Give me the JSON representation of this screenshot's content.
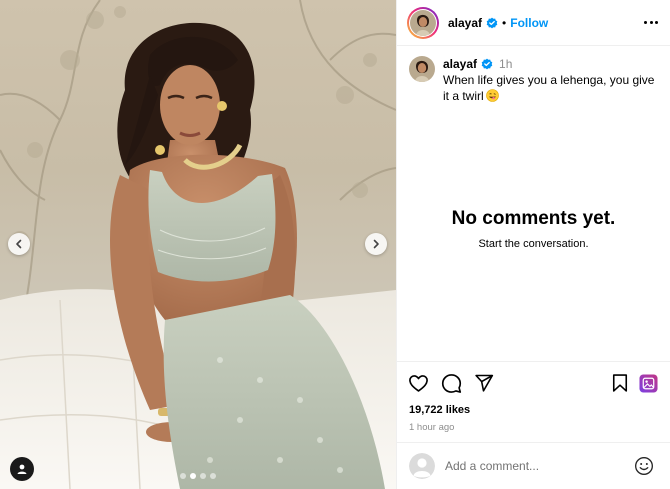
{
  "post": {
    "username": "alayaf",
    "follow_label": "Follow",
    "separator": "•",
    "caption_text": "When life gives you a lehenga, you give it a twirl",
    "caption_time": "1h",
    "caption_emoji": "grinning-tongue-emoji",
    "likes": "19,722 likes",
    "posted_ago": "1 hour ago"
  },
  "comments": {
    "empty_title": "No comments yet.",
    "empty_subtitle": "Start the conversation."
  },
  "comment_box": {
    "placeholder": "Add a comment..."
  },
  "carousel": {
    "slide_count": 4,
    "active_slide": 2
  },
  "icons": {
    "verified": "verified-badge-icon",
    "more": "more-options-icon",
    "like": "heart-icon",
    "comment": "comment-bubble-icon",
    "share": "send-icon",
    "save": "bookmark-icon",
    "media": "gallery-icon",
    "prev": "chevron-left-icon",
    "next": "chevron-right-icon",
    "tagged": "user-tag-icon",
    "emoji": "smiley-icon"
  },
  "colors": {
    "accent": "#0095f6",
    "verified": "#0095f6",
    "muted": "#8e8e8e"
  }
}
